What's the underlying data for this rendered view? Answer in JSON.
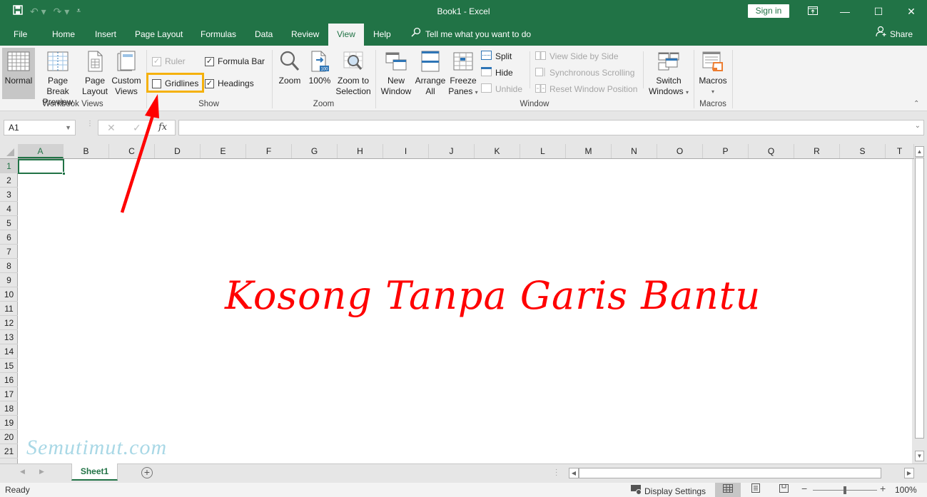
{
  "window": {
    "title": "Book1  -  Excel",
    "sign_in": "Sign in",
    "controls": {
      "ribbon_display": "ribbon-display-icon",
      "minimize": "minimize-icon",
      "maximize": "maximize-icon",
      "close": "close-icon"
    }
  },
  "qat": {
    "save": "save-icon",
    "undo": "undo-icon",
    "redo": "redo-icon",
    "customize": "customize-qat-icon"
  },
  "tabs": [
    {
      "label": "File"
    },
    {
      "label": "Home"
    },
    {
      "label": "Insert"
    },
    {
      "label": "Page Layout"
    },
    {
      "label": "Formulas"
    },
    {
      "label": "Data"
    },
    {
      "label": "Review"
    },
    {
      "label": "View",
      "active": true
    },
    {
      "label": "Help"
    }
  ],
  "tell_me": "Tell me what you want to do",
  "share": "Share",
  "ribbon": {
    "workbook_views": {
      "label": "Workbook Views",
      "normal": "Normal",
      "page_break_1": "Page Break",
      "page_break_2": "Preview",
      "page_layout_1": "Page",
      "page_layout_2": "Layout",
      "custom_1": "Custom",
      "custom_2": "Views"
    },
    "show": {
      "label": "Show",
      "ruler": {
        "label": "Ruler",
        "checked": true,
        "disabled": true
      },
      "formula_bar": {
        "label": "Formula Bar",
        "checked": true
      },
      "gridlines": {
        "label": "Gridlines",
        "checked": false
      },
      "headings": {
        "label": "Headings",
        "checked": true
      }
    },
    "zoom": {
      "label": "Zoom",
      "zoom": "Zoom",
      "hundred": "100%",
      "hundred_badge": "100",
      "zoom_sel_1": "Zoom to",
      "zoom_sel_2": "Selection"
    },
    "window": {
      "label": "Window",
      "new_1": "New",
      "new_2": "Window",
      "arrange_1": "Arrange",
      "arrange_2": "All",
      "freeze_1": "Freeze",
      "freeze_2": "Panes",
      "split": "Split",
      "hide": "Hide",
      "unhide": "Unhide",
      "side_by_side": "View Side by Side",
      "sync_scroll": "Synchronous Scrolling",
      "reset_pos": "Reset Window Position",
      "switch_1": "Switch",
      "switch_2": "Windows"
    },
    "macros": {
      "label": "Macros",
      "button": "Macros"
    }
  },
  "formula_bar": {
    "name_box": "A1",
    "fx": "fx",
    "value": ""
  },
  "columns": [
    "A",
    "B",
    "C",
    "D",
    "E",
    "F",
    "G",
    "H",
    "I",
    "J",
    "K",
    "L",
    "M",
    "N",
    "O",
    "P",
    "Q",
    "R",
    "S",
    "T"
  ],
  "rows": [
    "1",
    "2",
    "3",
    "4",
    "5",
    "6",
    "7",
    "8",
    "9",
    "10",
    "11",
    "12",
    "13",
    "14",
    "15",
    "16",
    "17",
    "18",
    "19",
    "20",
    "21"
  ],
  "active_cell": "A1",
  "overlay": {
    "caption": "Kosong Tanpa Garis Bantu",
    "watermark": "Semutimut.com",
    "caption_color": "#ff0000",
    "highlight_color": "#f5b10c"
  },
  "sheets": [
    {
      "name": "Sheet1",
      "active": true
    }
  ],
  "status": {
    "ready": "Ready",
    "display_settings": "Display Settings",
    "zoom_pct": "100%",
    "zoom_level": 100
  }
}
